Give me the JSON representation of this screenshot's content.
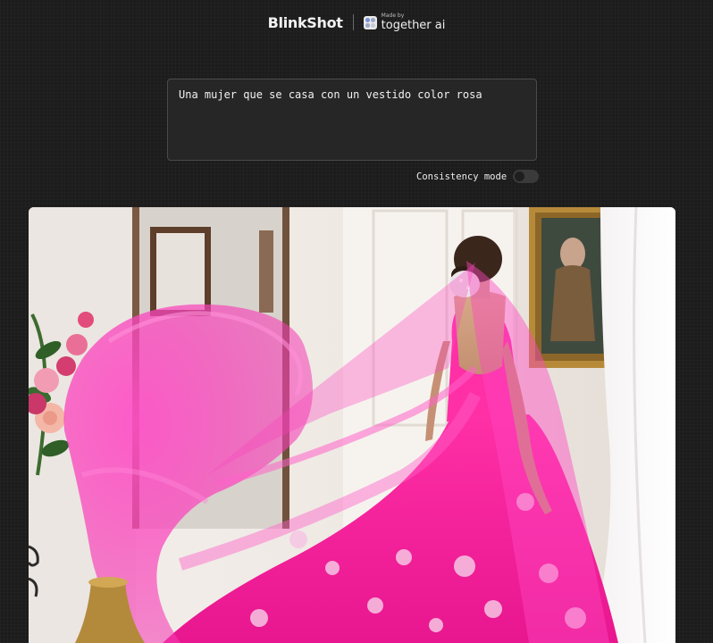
{
  "header": {
    "brand": "BlinkShot",
    "partner_made_by": "Made by",
    "partner_name": "together ai"
  },
  "prompt": {
    "value": "Una mujer que se casa con un vestido color rosa"
  },
  "options": {
    "consistency_label": "Consistency mode",
    "consistency_enabled": false
  },
  "image": {
    "subject": "bride in pink gown with flowing pink veil"
  }
}
